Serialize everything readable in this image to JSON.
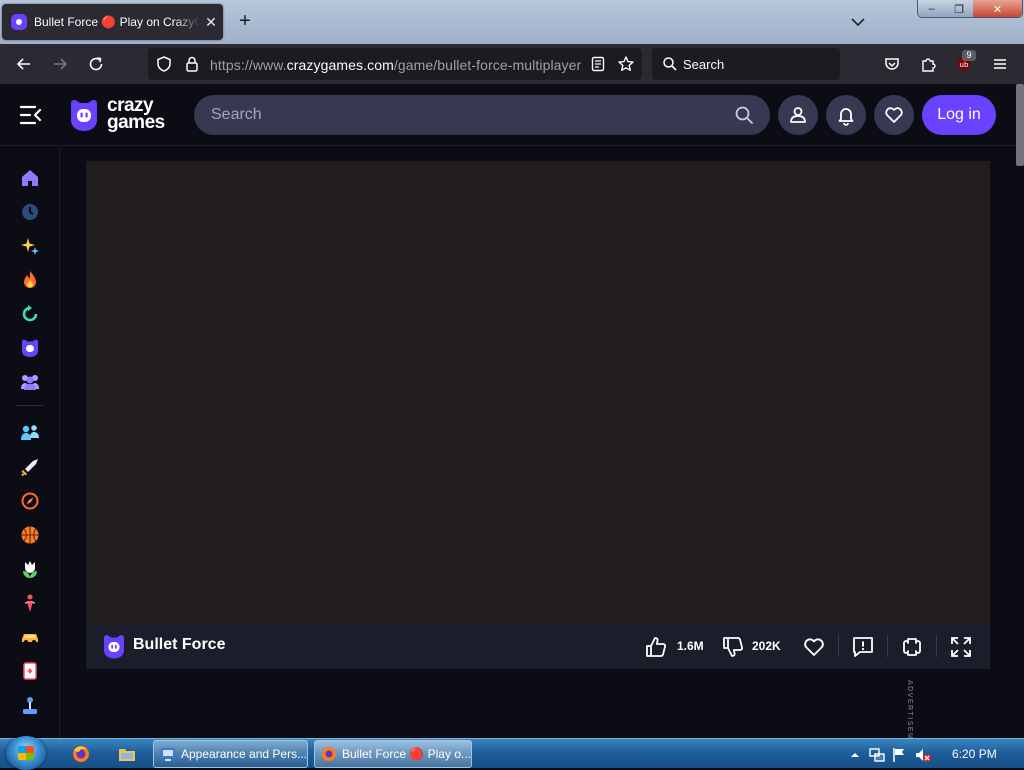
{
  "browser": {
    "tab_title": "Bullet Force 🔴 Play on CrazyGames",
    "tab_close": "✕",
    "new_tab": "+",
    "url_prefix": "https://www.",
    "url_domain": "crazygames.com",
    "url_path": "/game/bullet-force-multiplayer",
    "search_placeholder": "Search",
    "extension_badge": "9",
    "window_controls": {
      "min": "–",
      "max": "❐",
      "close": "✕"
    }
  },
  "site": {
    "logo_line1": "crazy",
    "logo_line2": "games",
    "search_placeholder": "Search",
    "login_label": "Log in",
    "accent_color": "#6842ff"
  },
  "sidebar": {
    "items": [
      {
        "icon": "home-icon"
      },
      {
        "icon": "recent-icon"
      },
      {
        "icon": "new-sparkle-icon"
      },
      {
        "icon": "trending-fire-icon"
      },
      {
        "icon": "updated-icon"
      },
      {
        "icon": "originals-icon"
      },
      {
        "icon": "multiplayer-icon"
      },
      {
        "icon": "two-player-icon"
      },
      {
        "icon": "action-sword-icon"
      },
      {
        "icon": "adventure-compass-icon"
      },
      {
        "icon": "basketball-icon"
      },
      {
        "icon": "beauty-flower-icon"
      },
      {
        "icon": "bike-icon"
      },
      {
        "icon": "car-icon"
      },
      {
        "icon": "card-icon"
      },
      {
        "icon": "casual-icon"
      }
    ]
  },
  "game": {
    "title": "Bullet Force",
    "likes": "1.6M",
    "dislikes": "202K",
    "ad_label": "ADVERTISEMENT"
  },
  "taskbar": {
    "items": [
      {
        "label": "Appearance and Pers..."
      },
      {
        "label": "Bullet Force 🔴 Play o..."
      }
    ],
    "clock": "6:20 PM"
  }
}
